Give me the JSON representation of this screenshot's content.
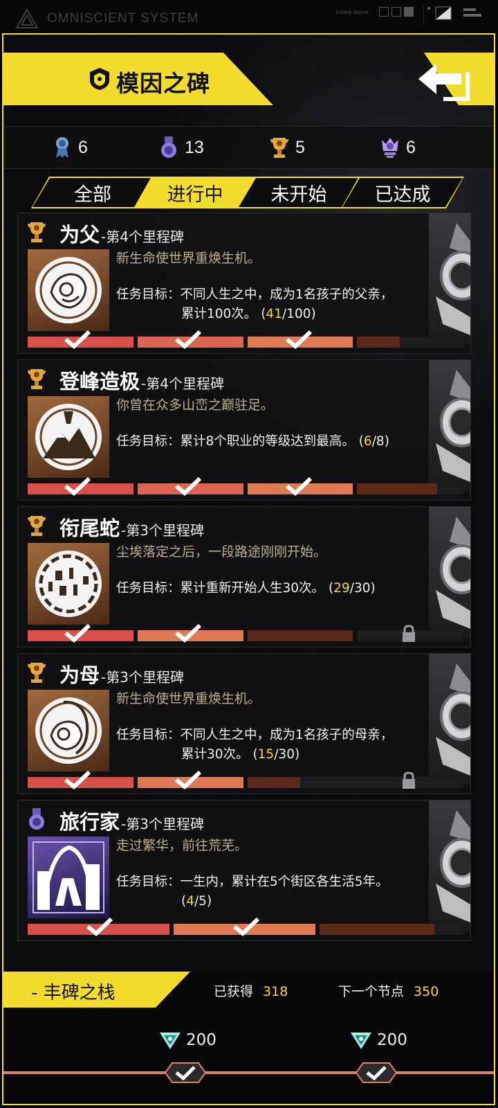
{
  "topbar": {
    "system_name": "OMNISCIENT SYSTEM",
    "lorem": "Lorem Ipsum"
  },
  "header": {
    "title": "模因之碑"
  },
  "counts": [
    {
      "icon": "blue-ribbon-medal-icon",
      "value": "6"
    },
    {
      "icon": "purple-medal-icon",
      "value": "13"
    },
    {
      "icon": "gold-trophy-icon",
      "value": "5"
    },
    {
      "icon": "purple-crown-trophy-icon",
      "value": "6"
    }
  ],
  "tabs": [
    {
      "label": "全部",
      "active": false
    },
    {
      "label": "进行中",
      "active": true
    },
    {
      "label": "未开始",
      "active": false
    },
    {
      "label": "已达成",
      "active": false
    }
  ],
  "milestones": [
    {
      "name": "为父",
      "stage": "-第4个里程碑",
      "desc": "新生命使世界重焕生机。",
      "goal_prefix": "任务目标：",
      "goal_text": "不同人生之中，成为1名孩子的父亲，",
      "goal_cont": "累计100次。",
      "progress_open": "(",
      "progress_current": "41",
      "progress_total": "/100)",
      "icon": "gold-trophy-icon",
      "art": "father-holding-baby-icon",
      "segments_done": 3,
      "segments_total": 4,
      "locked": false,
      "fraction": 0.41
    },
    {
      "name": "登峰造极",
      "stage": "-第4个里程碑",
      "desc": "你曾在众多山峦之巅驻足。",
      "goal_prefix": "任务目标：",
      "goal_text": "累计8个职业的等级达到最高。",
      "goal_cont": "",
      "progress_open": "(",
      "progress_current": "6",
      "progress_total": "/8)",
      "icon": "gold-trophy-icon",
      "art": "mountain-peak-suit-icon",
      "segments_done": 3,
      "segments_total": 4,
      "locked": false,
      "fraction": 0.75
    },
    {
      "name": "衔尾蛇",
      "stage": "-第3个里程碑",
      "desc": "尘埃落定之后，一段路途刚刚开始。",
      "goal_prefix": "任务目标：",
      "goal_text": "累计重新开始人生30次。",
      "goal_cont": "",
      "progress_open": "(",
      "progress_current": "29",
      "progress_total": "/30)",
      "icon": "gold-trophy-icon",
      "art": "ouroboros-numbers-icon",
      "segments_done": 2,
      "segments_total": 3,
      "locked": true,
      "fraction": 0.97
    },
    {
      "name": "为母",
      "stage": "-第3个里程碑",
      "desc": "新生命使世界重焕生机。",
      "goal_prefix": "任务目标：",
      "goal_text": "不同人生之中，成为1名孩子的母亲，",
      "goal_cont": "累计30次。",
      "progress_open": "(",
      "progress_current": "15",
      "progress_total": "/30)",
      "icon": "gold-trophy-icon",
      "art": "mother-holding-baby-icon",
      "segments_done": 2,
      "segments_total": 3,
      "locked": true,
      "fraction": 0.5
    },
    {
      "name": "旅行家",
      "stage": "-第3个里程碑",
      "desc": "走过繁华，前往荒芜。",
      "goal_prefix": "任务目标：",
      "goal_text": "一生内，累计在5个街区各生活5年。",
      "goal_cont": "",
      "progress_open": "(",
      "progress_current": "4",
      "progress_total": "/5)",
      "icon": "purple-medal-icon",
      "art": "walking-traveler-city-icon",
      "segments_done": 2,
      "segments_total": 3,
      "locked": false,
      "fraction": 0.8
    }
  ],
  "footer": {
    "title": "- 丰碑之栈",
    "earned_label": "已获得",
    "earned_value": "318",
    "next_label": "下一个节点",
    "next_value": "350",
    "rewards": [
      {
        "icon": "teal-gem-icon",
        "amount": "200",
        "claimed": true
      },
      {
        "icon": "teal-gem-icon",
        "amount": "200",
        "claimed": true
      }
    ]
  },
  "colors": {
    "accent": "#f2dc2c",
    "bar_red": "#d8504a",
    "bar_orange": "#e07a55",
    "bar_dark": "#5a2a1c"
  }
}
